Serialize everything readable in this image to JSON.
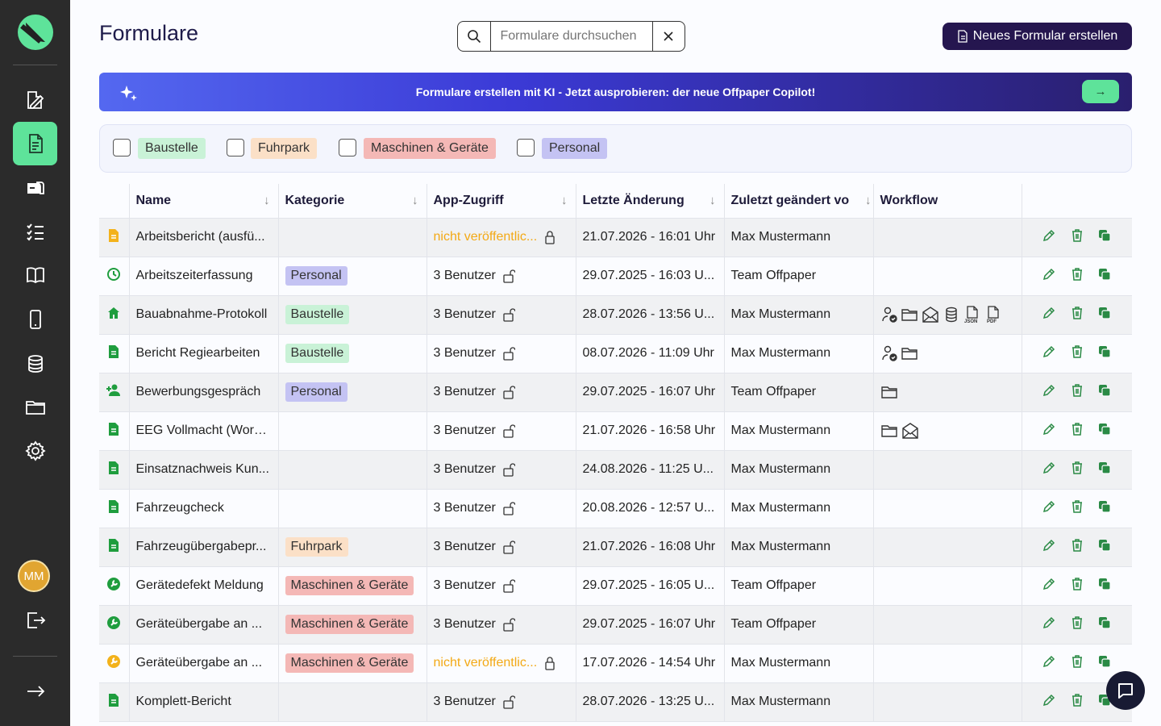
{
  "page": {
    "title": "Formulare",
    "search_placeholder": "Formulare durchsuchen",
    "new_button": "Neues Formular erstellen"
  },
  "banner": {
    "text": "Formulare erstellen mit KI - Jetzt ausprobieren: der neue Offpaper Copilot!",
    "arrow": "→"
  },
  "filters": [
    {
      "label": "Baustelle",
      "color": "#c9f2d7"
    },
    {
      "label": "Fuhrpark",
      "color": "#fbe0c7"
    },
    {
      "label": "Maschinen & Geräte",
      "color": "#f4b8b6"
    },
    {
      "label": "Personal",
      "color": "#c4c3f3"
    }
  ],
  "sidebar": {
    "avatar_initials": "MM",
    "expand_icon": "→"
  },
  "table": {
    "headers": [
      "Name",
      "Kategorie",
      "App-Zugriff",
      "Letzte Änderung",
      "Zuletzt geändert vo",
      "Workflow"
    ],
    "rows": [
      {
        "icon": "document-icon",
        "icon_color": "#f3b21b",
        "name": "Arbeitsbericht (ausfü...",
        "category": "",
        "access": "nicht veröffentlic...",
        "unpublished": true,
        "changed": "21.07.2026 - 16:01 Uhr",
        "by": "Max Mustermann",
        "workflow": []
      },
      {
        "icon": "clock-icon",
        "icon_color": "#1f9d3e",
        "name": "Arbeitszeiterfassung",
        "category": "Personal",
        "access": "3 Benutzer",
        "unpublished": false,
        "changed": "29.07.2025 - 16:03 U...",
        "by": "Team Offpaper",
        "workflow": []
      },
      {
        "icon": "home-icon",
        "icon_color": "#1f9d3e",
        "name": "Bauabnahme-Protokoll",
        "category": "Baustelle",
        "access": "3 Benutzer",
        "unpublished": false,
        "changed": "28.07.2026 - 13:56 U...",
        "by": "Max Mustermann",
        "workflow": [
          "user-check-icon",
          "folder-icon",
          "mail-icon",
          "database-icon",
          "json-icon",
          "pdf-icon"
        ]
      },
      {
        "icon": "document-icon",
        "icon_color": "#1f9d3e",
        "name": "Bericht Regiearbeiten",
        "category": "Baustelle",
        "access": "3 Benutzer",
        "unpublished": false,
        "changed": "08.07.2026 - 11:09 Uhr",
        "by": "Max Mustermann",
        "workflow": [
          "user-check-icon",
          "folder-icon"
        ]
      },
      {
        "icon": "user-plus-icon",
        "icon_color": "#1f9d3e",
        "name": "Bewerbungsgespräch",
        "category": "Personal",
        "access": "3 Benutzer",
        "unpublished": false,
        "changed": "29.07.2025 - 16:07 Uhr",
        "by": "Team Offpaper",
        "workflow": [
          "folder-icon"
        ]
      },
      {
        "icon": "document-icon",
        "icon_color": "#1f9d3e",
        "name": "EEG Vollmacht (Word...",
        "category": "",
        "access": "3 Benutzer",
        "unpublished": false,
        "changed": "21.07.2026 - 16:58 Uhr",
        "by": "Max Mustermann",
        "workflow": [
          "folder-icon",
          "mail-icon"
        ]
      },
      {
        "icon": "document-icon",
        "icon_color": "#1f9d3e",
        "name": "Einsatznachweis Kun...",
        "category": "",
        "access": "3 Benutzer",
        "unpublished": false,
        "changed": "24.08.2026 - 11:25 U...",
        "by": "Max Mustermann",
        "workflow": []
      },
      {
        "icon": "document-icon",
        "icon_color": "#1f9d3e",
        "name": "Fahrzeugcheck",
        "category": "",
        "access": "3 Benutzer",
        "unpublished": false,
        "changed": "20.08.2026 - 12:57 U...",
        "by": "Max Mustermann",
        "workflow": []
      },
      {
        "icon": "document-icon",
        "icon_color": "#1f9d3e",
        "name": "Fahrzeugübergabepr...",
        "category": "Fuhrpark",
        "access": "3 Benutzer",
        "unpublished": false,
        "changed": "21.07.2026 - 16:08 Uhr",
        "by": "Max Mustermann",
        "workflow": []
      },
      {
        "icon": "wrench-icon",
        "icon_color": "#1f9d3e",
        "name": "Gerätedefekt Meldung",
        "category": "Maschinen & Geräte",
        "access": "3 Benutzer",
        "unpublished": false,
        "changed": "29.07.2025 - 16:05 U...",
        "by": "Team Offpaper",
        "workflow": []
      },
      {
        "icon": "wrench-icon",
        "icon_color": "#1f9d3e",
        "name": "Geräteübergabe an ...",
        "category": "Maschinen & Geräte",
        "access": "3 Benutzer",
        "unpublished": false,
        "changed": "29.07.2025 - 16:07 Uhr",
        "by": "Team Offpaper",
        "workflow": []
      },
      {
        "icon": "wrench-icon",
        "icon_color": "#f3b21b",
        "name": "Geräteübergabe an ...",
        "category": "Maschinen & Geräte",
        "access": "nicht veröffentlic...",
        "unpublished": true,
        "changed": "17.07.2026 - 14:54 Uhr",
        "by": "Max Mustermann",
        "workflow": []
      },
      {
        "icon": "document-icon",
        "icon_color": "#1f9d3e",
        "name": "Komplett-Bericht",
        "category": "",
        "access": "3 Benutzer",
        "unpublished": false,
        "changed": "28.07.2026 - 13:25 U...",
        "by": "Max Mustermann",
        "workflow": []
      }
    ]
  },
  "category_colors": {
    "Baustelle": "#c9f2d7",
    "Fuhrpark": "#fbe0c7",
    "Maschinen & Geräte": "#f4b8b6",
    "Personal": "#c4c3f3"
  }
}
